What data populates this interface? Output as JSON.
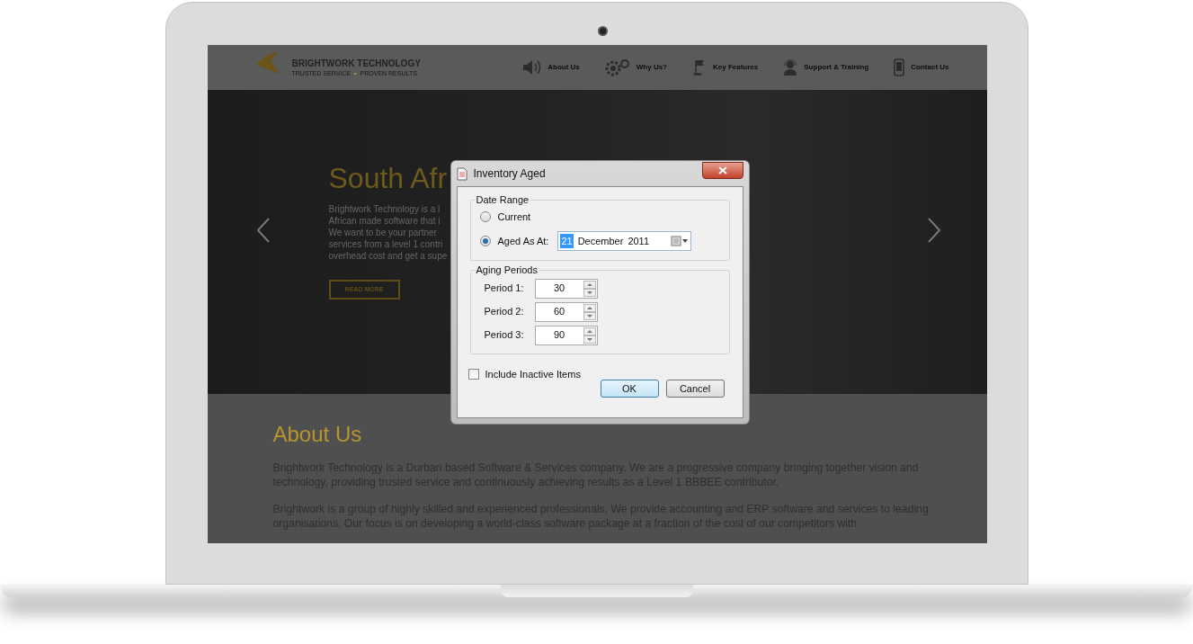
{
  "site": {
    "logo": {
      "title": "BRIGHTWORK TECHNOLOGY",
      "tagline": [
        "TRUSTED SERVICE",
        "•",
        "PROVEN RESULTS"
      ]
    },
    "nav": [
      {
        "label": "About Us"
      },
      {
        "label": "Why Us?"
      },
      {
        "label": "Key Features"
      },
      {
        "label": "Support & Training"
      },
      {
        "label": "Contact Us"
      }
    ],
    "hero": {
      "heading": "South Afr",
      "lines": [
        "Brightwork Technology is a l",
        "African made software that i",
        "We want to be your partner",
        "services from a level 1 contri",
        "overhead cost and get a supe"
      ],
      "button": "READ MORE"
    },
    "about": {
      "heading": "About Us",
      "paragraphs": [
        "Brightwork Technology is a Durban based Software & Services company. We are a progressive company bringing together vision and technology, providing trusted service and continuously achieving results as a Level 1 BBBEE contributor.",
        "Brightwork is a group of highly skilled and experienced professionals. We provide accounting and ERP software and services to leading organisations. Our focus is on developing a world-class software package at a fraction of the cost of our competitors with"
      ]
    }
  },
  "dialog": {
    "title": "Inventory Aged",
    "date_range": {
      "legend": "Date Range",
      "options": [
        {
          "label": "Current",
          "selected": false
        },
        {
          "label": "Aged As At:",
          "selected": true
        }
      ],
      "date": {
        "day": "21",
        "month": "December",
        "year": "2011"
      }
    },
    "aging_periods": {
      "legend": "Aging Periods",
      "periods": [
        {
          "label": "Period 1:",
          "value": "30"
        },
        {
          "label": "Period 2:",
          "value": "60"
        },
        {
          "label": "Period 3:",
          "value": "90"
        }
      ]
    },
    "include_inactive": {
      "label": "Include Inactive Items",
      "checked": false
    },
    "buttons": [
      {
        "label": "OK",
        "default": true
      },
      {
        "label": "Cancel",
        "default": false
      }
    ]
  }
}
